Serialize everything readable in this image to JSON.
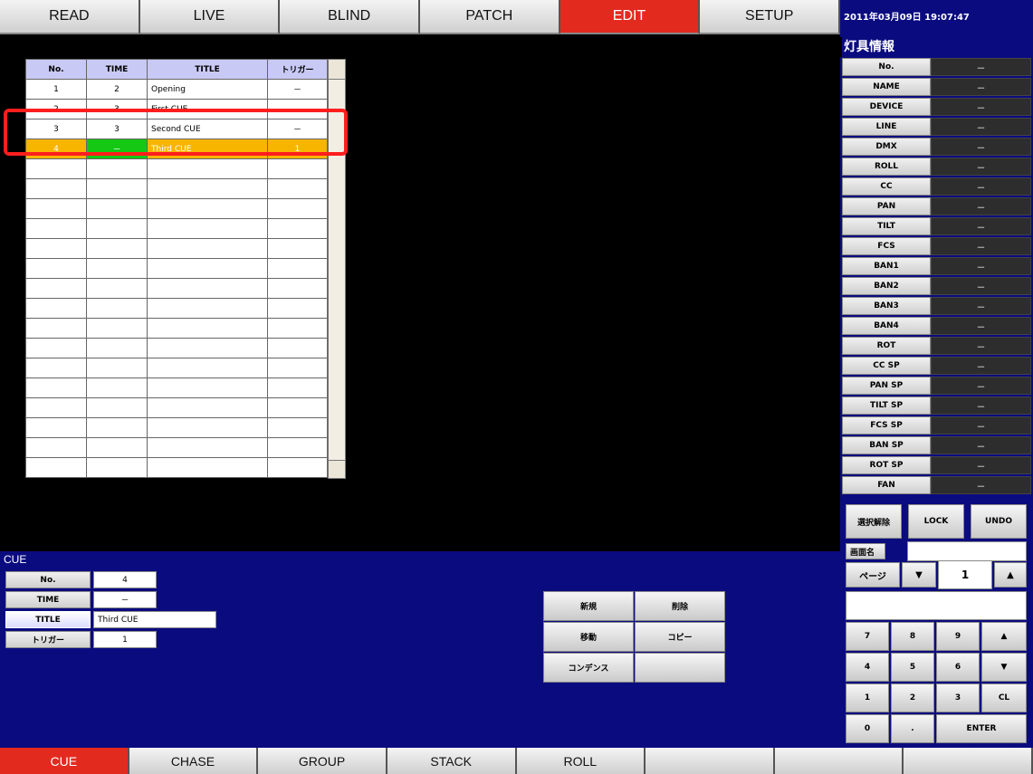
{
  "top_tabs": [
    {
      "label": "READ",
      "active": false
    },
    {
      "label": "LIVE",
      "active": false
    },
    {
      "label": "BLIND",
      "active": false
    },
    {
      "label": "PATCH",
      "active": false
    },
    {
      "label": "EDIT",
      "active": true
    },
    {
      "label": "SETUP",
      "active": false
    }
  ],
  "clock": "2011年03月09日 19:07:47",
  "info_title": "灯具情報",
  "cue_table": {
    "headers": [
      "No.",
      "TIME",
      "TITLE",
      "トリガー"
    ],
    "rows": [
      {
        "no": "1",
        "time": "2",
        "title": "Opening",
        "trigger": "－"
      },
      {
        "no": "2",
        "time": "3",
        "title": "First CUE",
        "trigger": "－"
      },
      {
        "no": "3",
        "time": "3",
        "title": "Second CUE",
        "trigger": "－"
      },
      {
        "no": "4",
        "time": "－",
        "title": "Third CUE",
        "trigger": "1",
        "selected": true
      }
    ],
    "empty_rows": 16
  },
  "fixture_info": [
    {
      "label": "No.",
      "value": "－"
    },
    {
      "label": "NAME",
      "value": "－"
    },
    {
      "label": "DEVICE",
      "value": "－"
    },
    {
      "label": "LINE",
      "value": "－"
    },
    {
      "label": "DMX",
      "value": "－"
    },
    {
      "label": "ROLL",
      "value": "－"
    },
    {
      "label": "CC",
      "value": "－"
    },
    {
      "label": "PAN",
      "value": "－"
    },
    {
      "label": "TILT",
      "value": "－"
    },
    {
      "label": "FCS",
      "value": "－"
    },
    {
      "label": "BAN1",
      "value": "－"
    },
    {
      "label": "BAN2",
      "value": "－"
    },
    {
      "label": "BAN3",
      "value": "－"
    },
    {
      "label": "BAN4",
      "value": "－"
    },
    {
      "label": "ROT",
      "value": "－"
    },
    {
      "label": "CC SP",
      "value": "－"
    },
    {
      "label": "PAN SP",
      "value": "－"
    },
    {
      "label": "TILT SP",
      "value": "－"
    },
    {
      "label": "FCS SP",
      "value": "－"
    },
    {
      "label": "BAN SP",
      "value": "－"
    },
    {
      "label": "ROT SP",
      "value": "－"
    },
    {
      "label": "FAN",
      "value": "－"
    }
  ],
  "controls": {
    "deselect": "選択解除",
    "lock": "LOCK",
    "undo": "UNDO",
    "screen_name_label": "画面名",
    "page_label": "ページ",
    "page_down_icon": "triangle-down",
    "page_value": "1",
    "page_up_icon": "triangle-up",
    "keypad": [
      "7",
      "8",
      "9",
      "4",
      "5",
      "6",
      "1",
      "2",
      "3",
      "0",
      "."
    ],
    "clear": "CL",
    "enter": "ENTER"
  },
  "cue_panel": {
    "title": "CUE",
    "fields": [
      {
        "label": "No.",
        "value": "4"
      },
      {
        "label": "TIME",
        "value": "－"
      },
      {
        "label": "TITLE",
        "value": "Third CUE"
      },
      {
        "label": "トリガー",
        "value": "1"
      }
    ],
    "actions": {
      "new": "新規",
      "delete": "削除",
      "move": "移動",
      "copy": "コピー",
      "condense": "コンデンス"
    }
  },
  "bottom_tabs": [
    {
      "label": "CUE",
      "active": true
    },
    {
      "label": "CHASE",
      "active": false
    },
    {
      "label": "GROUP",
      "active": false
    },
    {
      "label": "STACK",
      "active": false
    },
    {
      "label": "ROLL",
      "active": false
    },
    {
      "label": "",
      "active": false
    },
    {
      "label": "",
      "active": false
    },
    {
      "label": "",
      "active": false
    }
  ],
  "colors": {
    "panel_blue": "#0b0b80",
    "active_red": "#e32a1f",
    "selected_row": "#f7b500",
    "time_green": "#14c814",
    "highlight": "#ff1e1e"
  }
}
